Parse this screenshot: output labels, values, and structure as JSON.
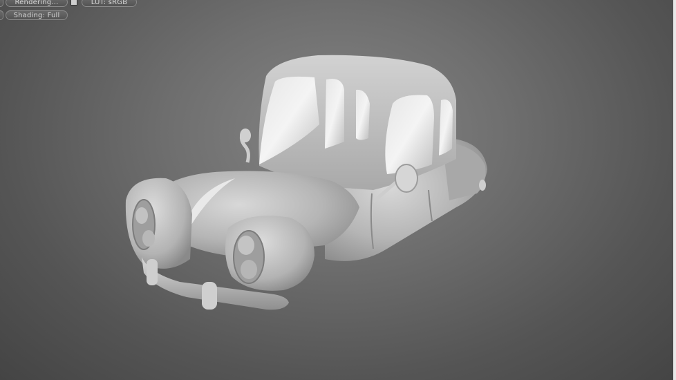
{
  "viewport_toolbar": {
    "render_status_label": "Rendering...",
    "lut_label": "LUT: sRGB",
    "shading_label": "Shading: Full"
  },
  "scene": {
    "object_icon": "cartoon-car-model",
    "background_color": "#707070",
    "model_color": "#c8c8c8"
  }
}
